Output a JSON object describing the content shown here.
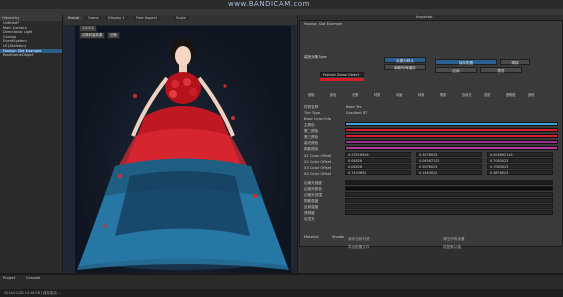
{
  "watermark": "www.BANDICAM.com",
  "hierarchy": {
    "tab": "Hierarchy",
    "search": "All",
    "items": [
      "Untitled*",
      "Main Camera",
      "Directional Light",
      "Canvas",
      "EventSystem",
      "UI (Skeleton)",
      "Fashion Slot Example",
      "RootGameObject"
    ]
  },
  "scene": {
    "tabs": [
      "Scene",
      "Game",
      "Display 1",
      "Free Aspect",
      "Scale"
    ],
    "mini_buttons": [
      "1.0.0.1",
      "切换时装效果",
      "切换"
    ]
  },
  "inspector": {
    "tab": "Inspector",
    "component": "Fashion Slot Example",
    "source_label": "装扮对象Type",
    "dropdown_value": "Fashion Game Object",
    "buttons": [
      "设置为默认",
      "刷新所有缓存",
      "保存配置",
      "清除",
      "应用",
      "预览"
    ],
    "tab_row": [
      "基础",
      "颜色",
      "光照",
      "材质",
      "动画",
      "特效",
      "阴影",
      "边缘光",
      "发射",
      "透明度",
      "其他"
    ],
    "rows": [
      {
        "label": "材质名称",
        "value": "Base Tex"
      },
      {
        "label": "Tint Type",
        "value": "Gradient RT"
      },
      {
        "label": "Base Color Info",
        "value": ""
      }
    ],
    "color_rows": [
      "主颜色",
      "第二颜色",
      "第三颜色",
      "高光颜色",
      "阴影颜色"
    ],
    "color_hex": [
      "#3aa3d8",
      "#d4202c",
      "#d4202c",
      "#9a3090",
      "#b63a9e"
    ],
    "vec_rows": [
      {
        "label": "X1 Color Offset",
        "vals": [
          "0.23318926",
          "0.3078023",
          "0.004892144"
        ]
      },
      {
        "label": "X2 Color Offset",
        "vals": [
          "0.04826",
          "0.04567132",
          "0.7083023"
        ]
      },
      {
        "label": "X3 Color Offset",
        "vals": [
          "0.04826",
          "0.3078023",
          "0.7083023"
        ]
      },
      {
        "label": "X4 Color Offset",
        "vals": [
          "0.7433892",
          "0.1483022",
          "0.3878023"
        ]
      }
    ],
    "lower_rows": [
      "边缘光强度",
      "边缘光颜色",
      "边缘光范围",
      "阴影强度",
      "反射强度",
      "透明度",
      "自发光"
    ],
    "foot_labels": [
      "Material",
      "Shader"
    ],
    "foot_options": [
      "保存当前材质",
      "导出配置文件",
      "清空所有设置",
      "恢复默认值"
    ]
  },
  "console": {
    "tabs": [
      "Project",
      "Console"
    ]
  },
  "status_text": "2024/11/28 14:16:28 | 保存成功 ..."
}
